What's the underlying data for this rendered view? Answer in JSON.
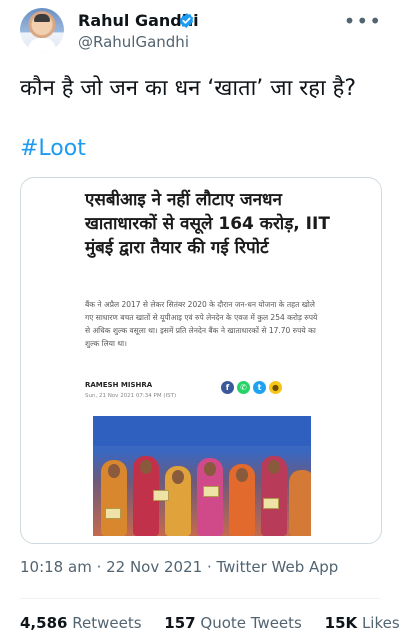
{
  "author": {
    "name": "Rahul Gandhi",
    "handle": "@RahulGandhi",
    "verified": true,
    "verified_icon": "verified-badge-icon",
    "verified_color": "#1d9bf0"
  },
  "more_menu": {
    "label": "•••",
    "icon": "more-options-icon"
  },
  "tweet": {
    "text": "कौन है जो जन का धन ‘खाता’ जा रहा है?",
    "hashtag": "#Loot",
    "hashtag_color": "#1d9bf0"
  },
  "card": {
    "headline": "एसबीआइ ने नहीं लौटाए जनधन खाताधारकों से वसूले 164 करोड़, IIT मुंबई द्वारा तैयार की गई रिपोर्ट",
    "excerpt": "बैंक ने अप्रैल 2017 से लेकर सितंबर 2020 के दौरान जन-धन योजना के तहत खोले गए साधारण बचत खातों से यूपीआइ एवं रुपे लेनदेन के एवज में कुल 254 करोड़ रुपये से अधिक शुल्क वसूला था। इसमें प्रति लेनदेन बैंक ने खाताधारकों से 17.70 रुपये का शुल्क लिया था।",
    "byline": "RAMESH MISHRA",
    "date": "Sun, 21 Nov 2021 07:34 PM (IST)",
    "share_icons": [
      "facebook-icon",
      "whatsapp-icon",
      "twitter-icon",
      "koo-icon"
    ]
  },
  "meta": {
    "timestamp": "10:18 am · 22 Nov 2021 · Twitter Web App"
  },
  "stats": {
    "retweets_count": "4,586",
    "retweets_label": "Retweets",
    "quotes_count": "157",
    "quotes_label": "Quote Tweets",
    "likes_count": "15K",
    "likes_label": "Likes"
  }
}
